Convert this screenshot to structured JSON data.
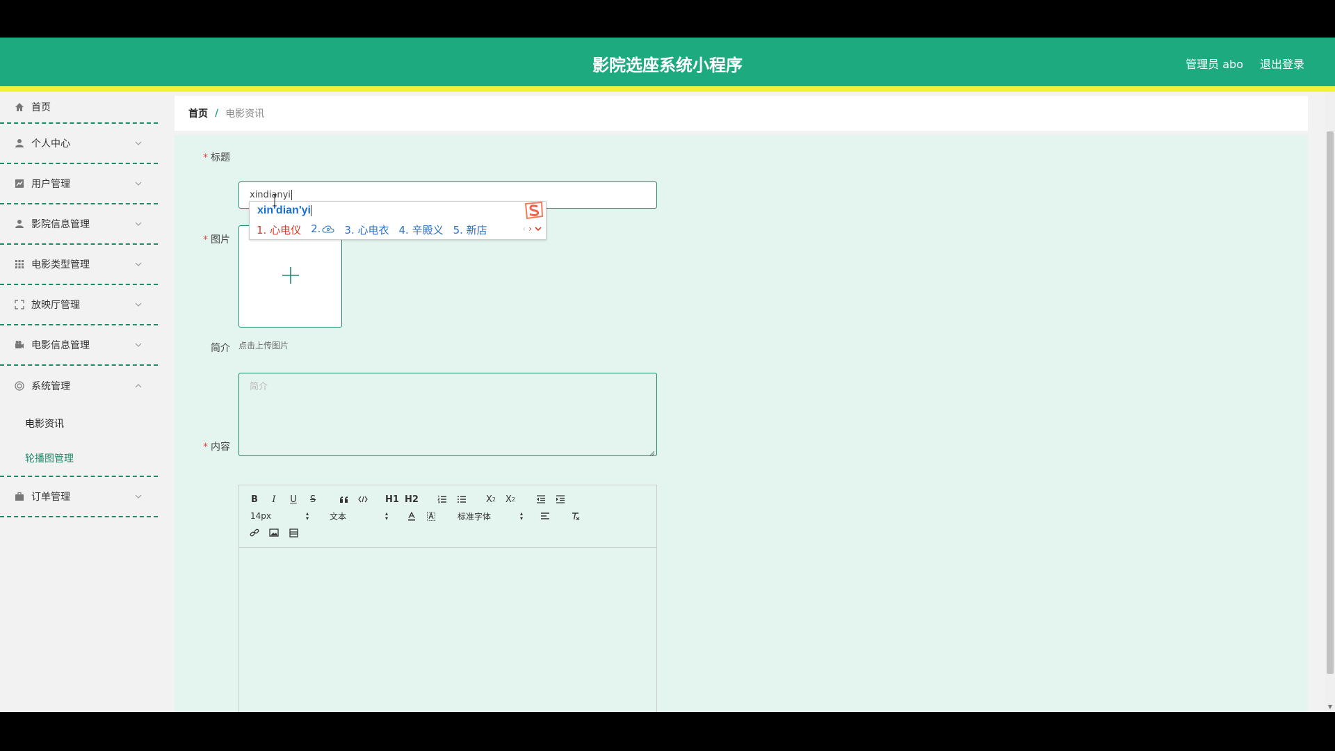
{
  "header": {
    "title": "影院选座系统小程序",
    "user": "管理员 abo",
    "logout": "退出登录"
  },
  "sidebar": {
    "items": [
      {
        "label": "首页",
        "icon": "home-icon"
      },
      {
        "label": "个人中心",
        "icon": "user-icon"
      },
      {
        "label": "用户管理",
        "icon": "chart-icon"
      },
      {
        "label": "影院信息管理",
        "icon": "person-icon"
      },
      {
        "label": "电影类型管理",
        "icon": "grid-icon"
      },
      {
        "label": "放映厅管理",
        "icon": "fullscreen-icon"
      },
      {
        "label": "电影信息管理",
        "icon": "video-icon"
      },
      {
        "label": "系统管理",
        "icon": "settings-icon"
      },
      {
        "label": "订单管理",
        "icon": "briefcase-icon"
      }
    ],
    "submenu": [
      {
        "label": "电影资讯"
      },
      {
        "label": "轮播图管理"
      }
    ]
  },
  "breadcrumb": {
    "home": "首页",
    "sep": "/",
    "current": "电影资讯"
  },
  "form": {
    "required_mark": "*",
    "title_label": "标题",
    "title_value": "xindianyi",
    "image_label": "图片",
    "upload_tip": "点击上传图片",
    "intro_label": "简介",
    "intro_placeholder": "简介",
    "content_label": "内容"
  },
  "editor": {
    "font_size": "14px",
    "heading": "文本",
    "font_family": "标准字体",
    "h1": "H1",
    "h2": "H2"
  },
  "ime": {
    "composition": "xin'dian'yi",
    "candidates": [
      "1. 心电仪",
      "2.",
      "3. 心电衣",
      "4. 辛殿义",
      "5. 新店"
    ]
  },
  "colors": {
    "primary": "#1eaa7f",
    "accent_bar": "#f2f23c",
    "content_bg": "#e4f4ee"
  }
}
